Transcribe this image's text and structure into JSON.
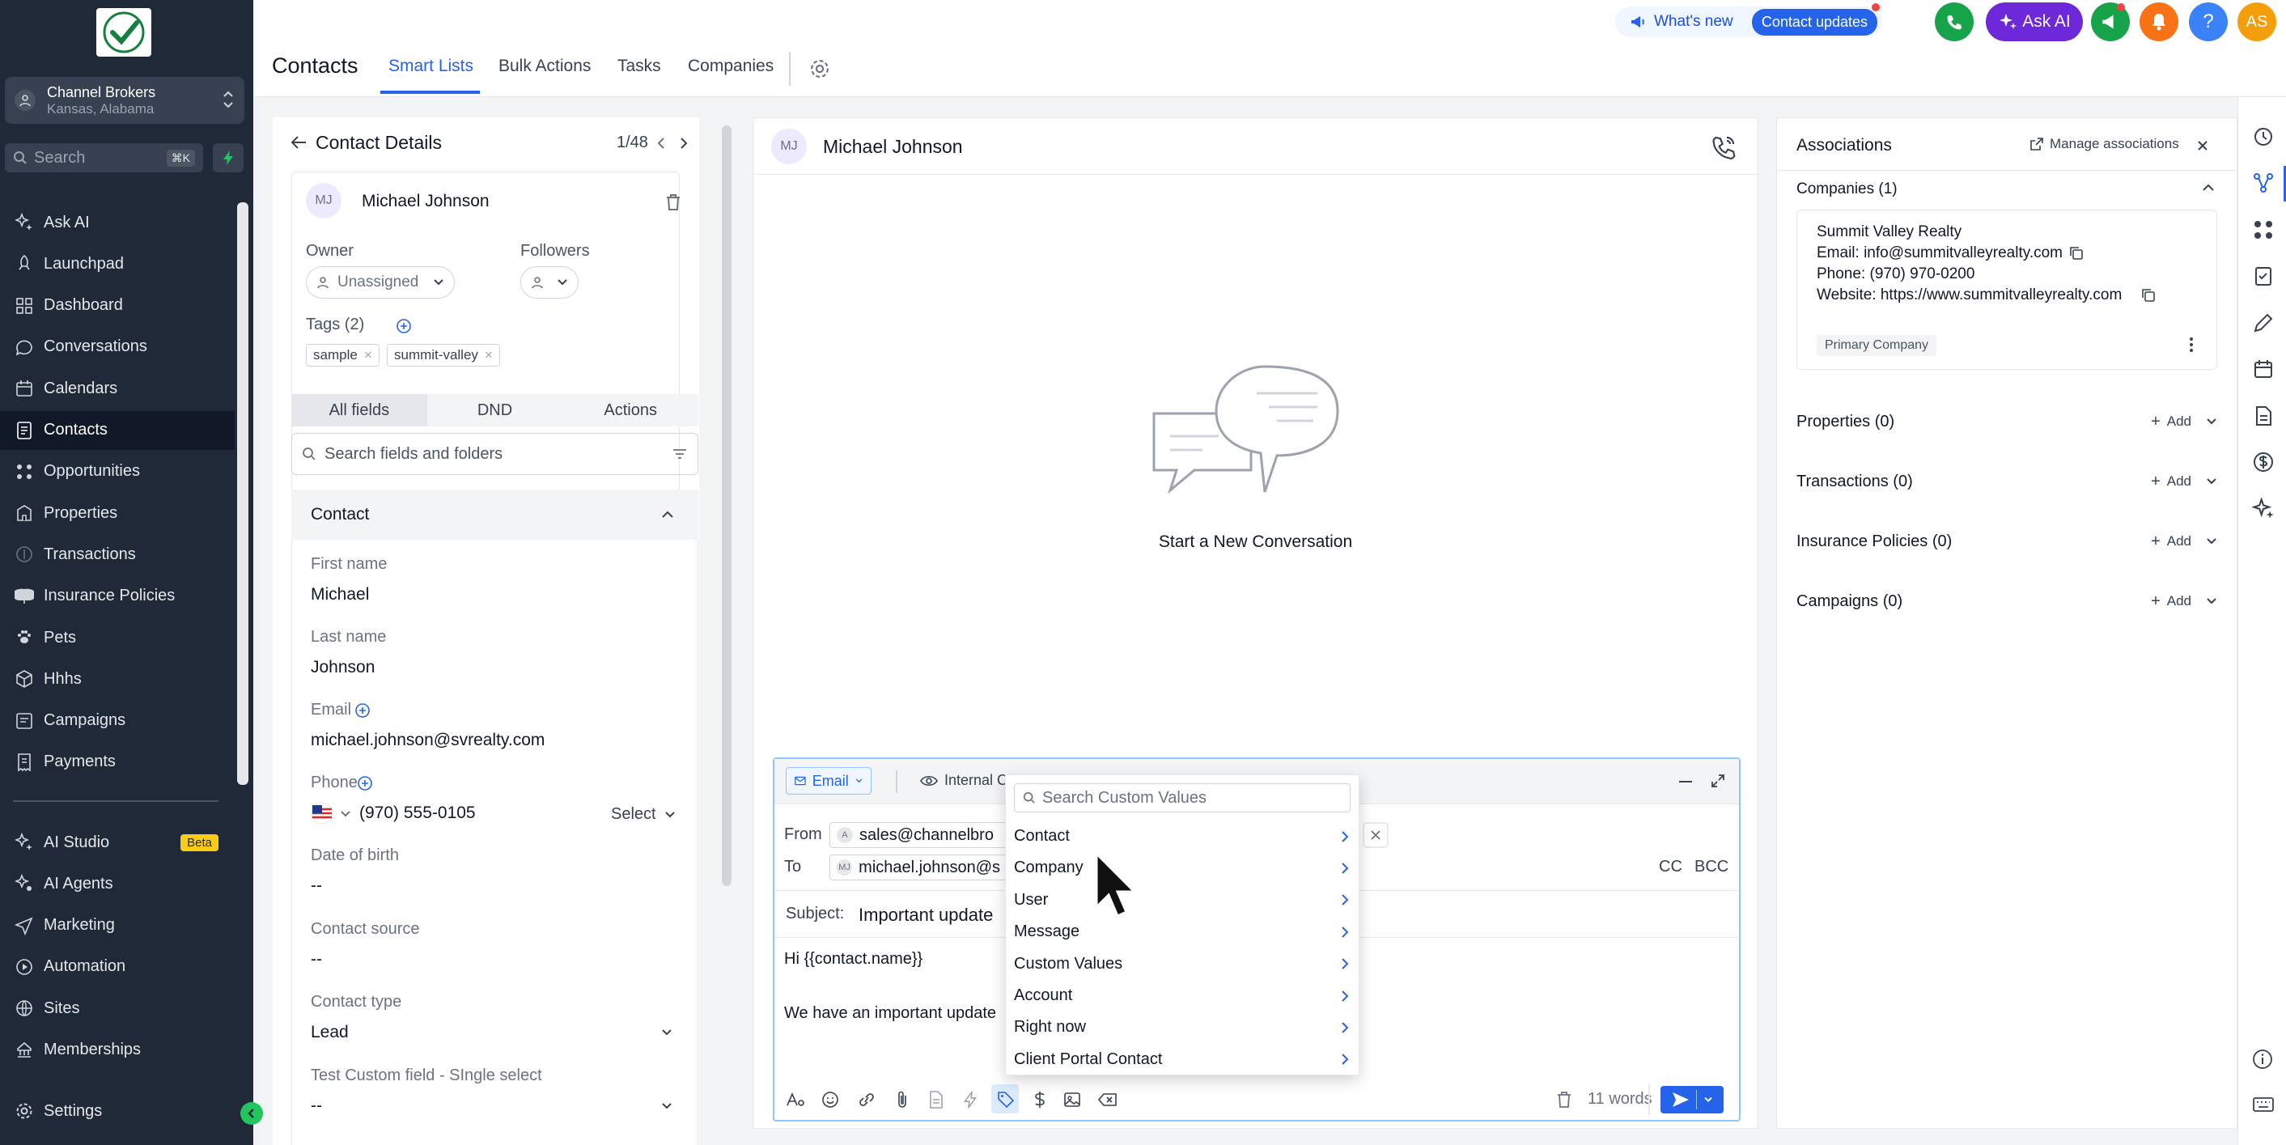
{
  "sidebar": {
    "location": {
      "name": "Channel Brokers",
      "address": "Kansas, Alabama"
    },
    "search": {
      "placeholder": "Search",
      "shortcut": "⌘K"
    },
    "items": [
      {
        "label": "Ask AI",
        "icon": "sparkles-icon"
      },
      {
        "label": "Launchpad",
        "icon": "rocket-icon"
      },
      {
        "label": "Dashboard",
        "icon": "dashboard-icon"
      },
      {
        "label": "Conversations",
        "icon": "chat-icon"
      },
      {
        "label": "Calendars",
        "icon": "calendar-icon"
      },
      {
        "label": "Contacts",
        "icon": "contacts-icon",
        "active": true
      },
      {
        "label": "Opportunities",
        "icon": "opportunities-icon"
      },
      {
        "label": "Properties",
        "icon": "building-icon"
      },
      {
        "label": "Transactions",
        "icon": "dollar-icon"
      },
      {
        "label": "Insurance Policies",
        "icon": "umbrella-icon"
      },
      {
        "label": "Pets",
        "icon": "paw-icon"
      },
      {
        "label": "Hhhs",
        "icon": "cube-icon"
      },
      {
        "label": "Campaigns",
        "icon": "campaign-icon"
      },
      {
        "label": "Payments",
        "icon": "receipt-icon"
      }
    ],
    "items2": [
      {
        "label": "AI Studio",
        "icon": "ai-studio-icon",
        "badge": "Beta"
      },
      {
        "label": "AI Agents",
        "icon": "ai-agents-icon"
      },
      {
        "label": "Marketing",
        "icon": "send-icon"
      },
      {
        "label": "Automation",
        "icon": "automation-icon"
      },
      {
        "label": "Sites",
        "icon": "globe-icon"
      },
      {
        "label": "Memberships",
        "icon": "membership-icon"
      }
    ],
    "settings": "Settings"
  },
  "header": {
    "title": "Contacts",
    "tabs": [
      "Smart Lists",
      "Bulk Actions",
      "Tasks",
      "Companies"
    ],
    "whats_new": "What's new",
    "contact_updates": "Contact updates",
    "ask_ai": "Ask AI",
    "avatar": "AS",
    "help": "?"
  },
  "contact": {
    "panel_title": "Contact Details",
    "counter": "1/48",
    "initials": "MJ",
    "name": "Michael Johnson",
    "owner_label": "Owner",
    "owner_value": "Unassigned",
    "followers_label": "Followers",
    "tags_label": "Tags (2)",
    "tags": [
      "sample",
      "summit-valley"
    ],
    "segments": [
      "All fields",
      "DND",
      "Actions"
    ],
    "field_search_placeholder": "Search fields and folders",
    "section": "Contact",
    "fields": {
      "first_name_label": "First name",
      "first_name": "Michael",
      "last_name_label": "Last name",
      "last_name": "Johnson",
      "email_label": "Email",
      "email": "michael.johnson@svrealty.com",
      "phone_label": "Phone",
      "phone": "(970) 555-0105",
      "phone_select": "Select",
      "dob_label": "Date of birth",
      "dob": "--",
      "source_label": "Contact source",
      "source": "--",
      "type_label": "Contact type",
      "type": "Lead",
      "custom_label": "Test Custom field - SIngle select",
      "custom": "--"
    }
  },
  "conversation": {
    "initials": "MJ",
    "name": "Michael Johnson",
    "empty_text": "Start a New Conversation",
    "channel": "Email",
    "internal": "Internal C",
    "from_label": "From",
    "from_value": "sales@channelbro",
    "from_initial": "A",
    "to_label": "To",
    "to_value": "michael.johnson@s",
    "to_initials": "MJ",
    "cc": "CC",
    "bcc": "BCC",
    "subject_label": "Subject:",
    "subject": "Important update",
    "body_line1": "Hi {{contact.name}}",
    "body_line2": "We have an important update",
    "word_count": "11 words"
  },
  "custom_values_menu": {
    "search_placeholder": "Search Custom Values",
    "items": [
      "Contact",
      "Company",
      "User",
      "Message",
      "Custom Values",
      "Account",
      "Right now",
      "Client Portal Contact"
    ]
  },
  "associations": {
    "title": "Associations",
    "manage": "Manage associations",
    "companies_header": "Companies (1)",
    "company": {
      "name": "Summit Valley Realty",
      "email": "Email: info@summitvalleyrealty.com",
      "phone": "Phone: (970) 970-0200",
      "website": "Website: https://www.summitvalleyrealty.com",
      "badge": "Primary Company"
    },
    "sections": [
      {
        "label": "Properties (0)",
        "add": "Add"
      },
      {
        "label": "Transactions (0)",
        "add": "Add"
      },
      {
        "label": "Insurance Policies (0)",
        "add": "Add"
      },
      {
        "label": "Campaigns (0)",
        "add": "Add"
      }
    ]
  },
  "colors": {
    "accent": "#2563eb",
    "sidebar": "#1f2937",
    "ask_ai": "#6d28d9",
    "phone_green": "#16a34a",
    "notify_orange": "#f97316"
  }
}
